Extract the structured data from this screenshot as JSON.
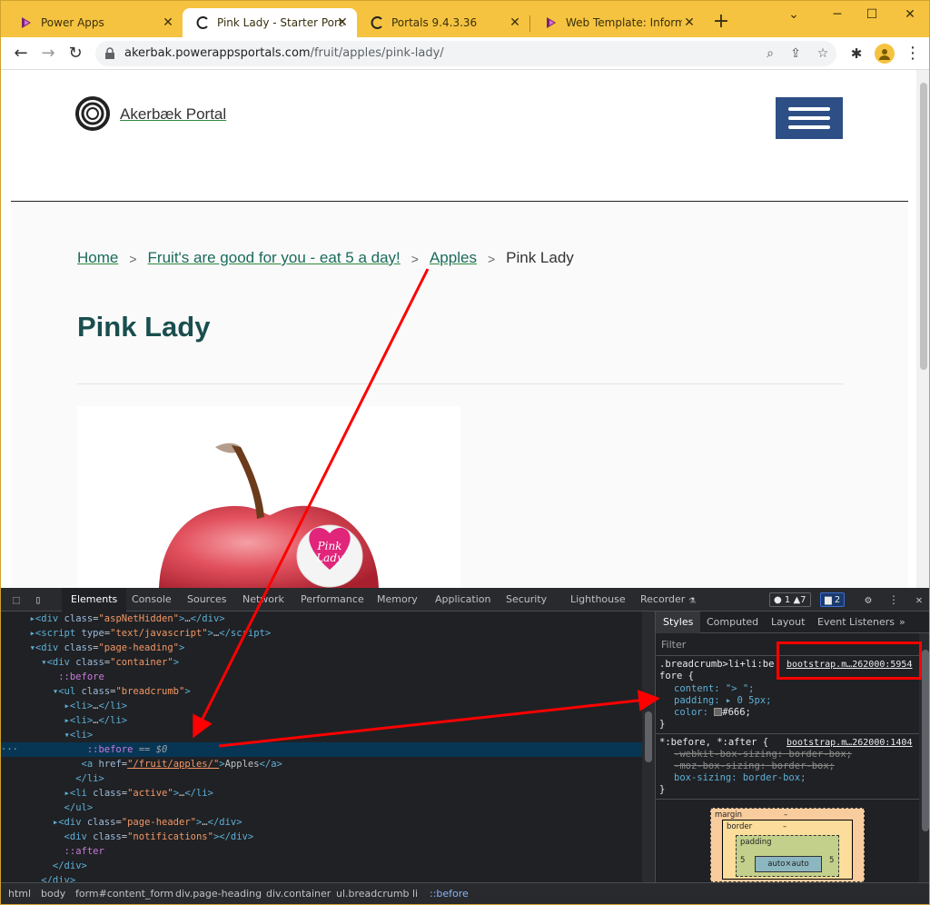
{
  "tabs": [
    {
      "title": "Power Apps",
      "icon": "powerapps-icon"
    },
    {
      "title": "Pink Lady - Starter Portal",
      "icon": "portal-icon"
    },
    {
      "title": "Portals 9.4.3.36",
      "icon": "portal-icon"
    },
    {
      "title": "Web Template: Informatio",
      "icon": "powerapps-icon"
    }
  ],
  "address": {
    "domain": "akerbak.powerappsportals.com",
    "path": "/fruit/apples/pink-lady/"
  },
  "portal": {
    "brand": "Akerbæk Portal",
    "breadcrumb": {
      "home": "Home",
      "fruit": "Fruit's are good for you - eat 5 a day!",
      "apples": "Apples",
      "current": "Pink Lady",
      "sep": ">"
    },
    "title": "Pink Lady",
    "sticker_text": "Pink Lady"
  },
  "devtools": {
    "tabs": [
      "Elements",
      "Console",
      "Sources",
      "Network",
      "Performance",
      "Memory",
      "Application",
      "Security",
      "Lighthouse",
      "Recorder"
    ],
    "badges": {
      "errors": "1",
      "warnings": "7",
      "messages": "2"
    },
    "styles_tabs": [
      "Styles",
      "Computed",
      "Layout",
      "Event Listeners"
    ],
    "filter_placeholder": "Filter",
    "breadcrumbs": [
      "html",
      "body",
      "form#content_form",
      "div.page-heading",
      "div.container",
      "ul.breadcrumb",
      "li",
      "::before"
    ]
  },
  "styles": {
    "rule1_selector_a": ".breadcrumb>li+li:be",
    "rule1_selector_b": "fore {",
    "rule1_source": "bootstrap.m…262000:5954",
    "rule1_content": "content: \"> \";",
    "rule1_padding": "padding: ▸ 0 5px;",
    "rule1_color_val": "#666;",
    "rule2_selector": "*:before, *:after {",
    "rule2_source": "bootstrap.m…262000:1404",
    "rule2_webkit": "-webkit-box-sizing: border-box;",
    "rule2_moz": "-moz-box-sizing: border-box;",
    "rule2_box": "box-sizing: border-box;"
  },
  "boxmodel": {
    "margin_label": "margin",
    "border_label": "border",
    "padding_label": "padding",
    "content": "auto×auto",
    "dash": "–",
    "padding_lr": "5"
  },
  "colors": {
    "tab_strip": "#f5c33f",
    "portal_link": "#1a6b5c",
    "heading": "#1a4e4e",
    "nav_button": "#2d4f86",
    "annotation": "#ff0000"
  }
}
